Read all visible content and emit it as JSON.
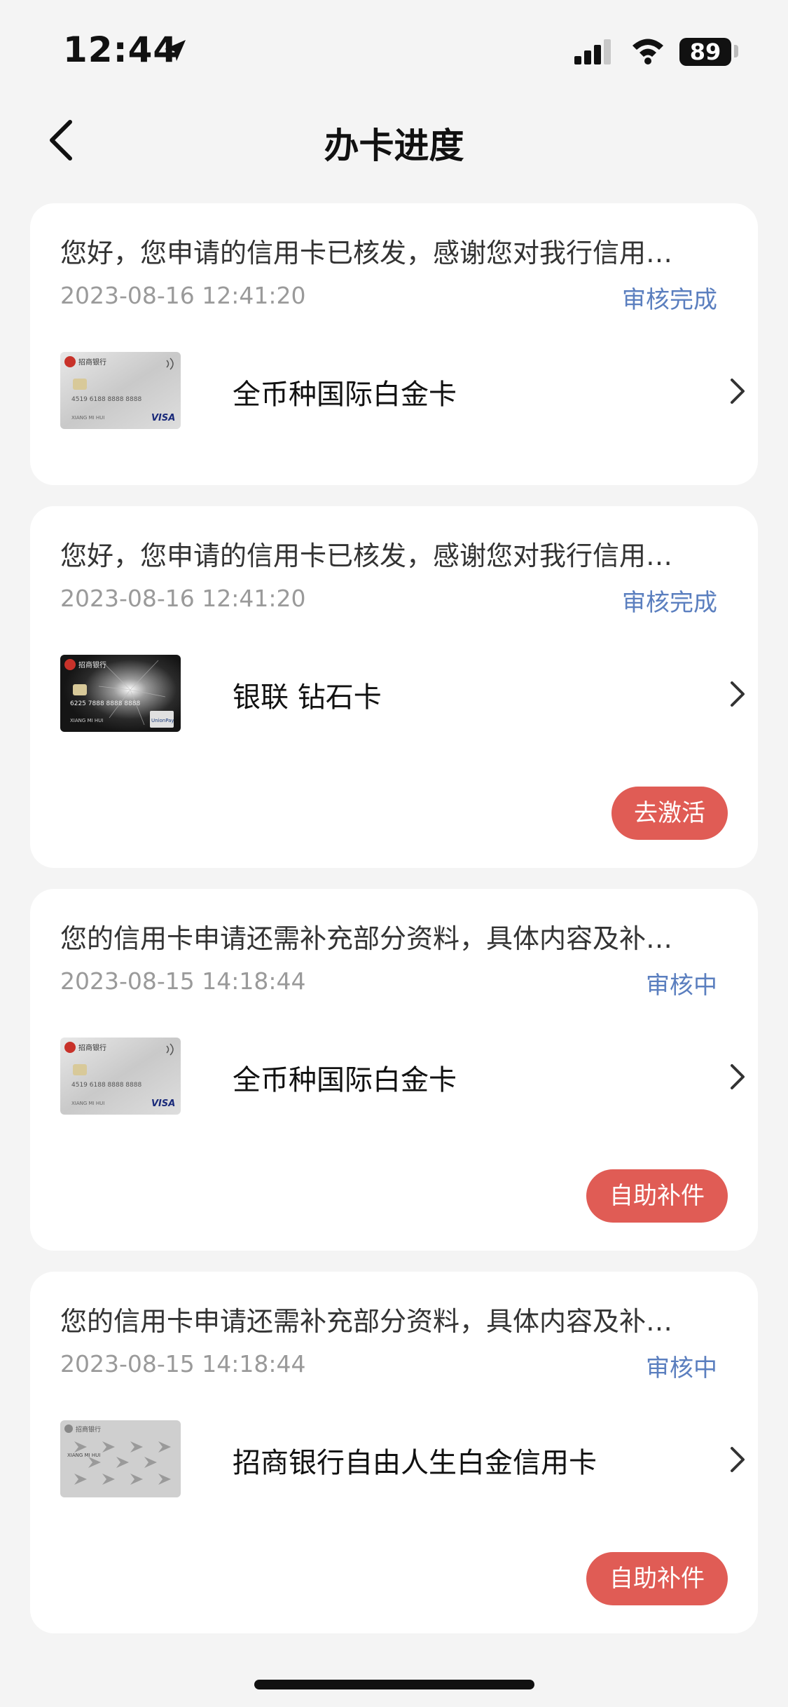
{
  "status_bar": {
    "time": "12:44",
    "battery": "89",
    "icons": [
      "location-arrow-icon",
      "signal-icon",
      "wifi-icon",
      "battery-icon"
    ]
  },
  "nav": {
    "title": "办卡进度",
    "back_icon": "chevron-left-icon"
  },
  "colors": {
    "status_blue": "#5b7fbf",
    "action_red": "#e05c55",
    "background": "#f4f4f4"
  },
  "cards": [
    {
      "message": "您好，您申请的信用卡已核发，感谢您对我行信用…",
      "date": "2023-08-16 12:41:20",
      "status": "审核完成",
      "card_name": "全币种国际白金卡",
      "thumb": {
        "bank_logo": "招商银行",
        "number": "4519 6188 8888 8888",
        "brand": "VISA",
        "name": "XIANG MI HUI",
        "style": "silver-visa"
      },
      "action": ""
    },
    {
      "message": "您好，您申请的信用卡已核发，感谢您对我行信用…",
      "date": "2023-08-16 12:41:20",
      "status": "审核完成",
      "card_name": "银联 钻石卡",
      "thumb": {
        "bank_logo": "招商银行",
        "number": "6225 7888 8888 8888",
        "brand": "UnionPay",
        "name": "XIANG MI HUI",
        "style": "black-diamond"
      },
      "action": "去激活"
    },
    {
      "message": "您的信用卡申请还需补充部分资料，具体内容及补…",
      "date": "2023-08-15 14:18:44",
      "status": "审核中",
      "card_name": "全币种国际白金卡",
      "thumb": {
        "bank_logo": "招商银行",
        "number": "4519 6188 8888 8888",
        "brand": "VISA",
        "name": "XIANG MI HUI",
        "style": "silver-visa"
      },
      "action": "自助补件"
    },
    {
      "message": "您的信用卡申请还需补充部分资料，具体内容及补…",
      "date": "2023-08-15 14:18:44",
      "status": "审核中",
      "card_name": "招商银行自由人生白金信用卡",
      "thumb": {
        "bank_logo": "招商银行",
        "number": "",
        "brand": "",
        "name": "XIANG MI HUI",
        "style": "grey-pattern"
      },
      "action": "自助补件"
    }
  ]
}
